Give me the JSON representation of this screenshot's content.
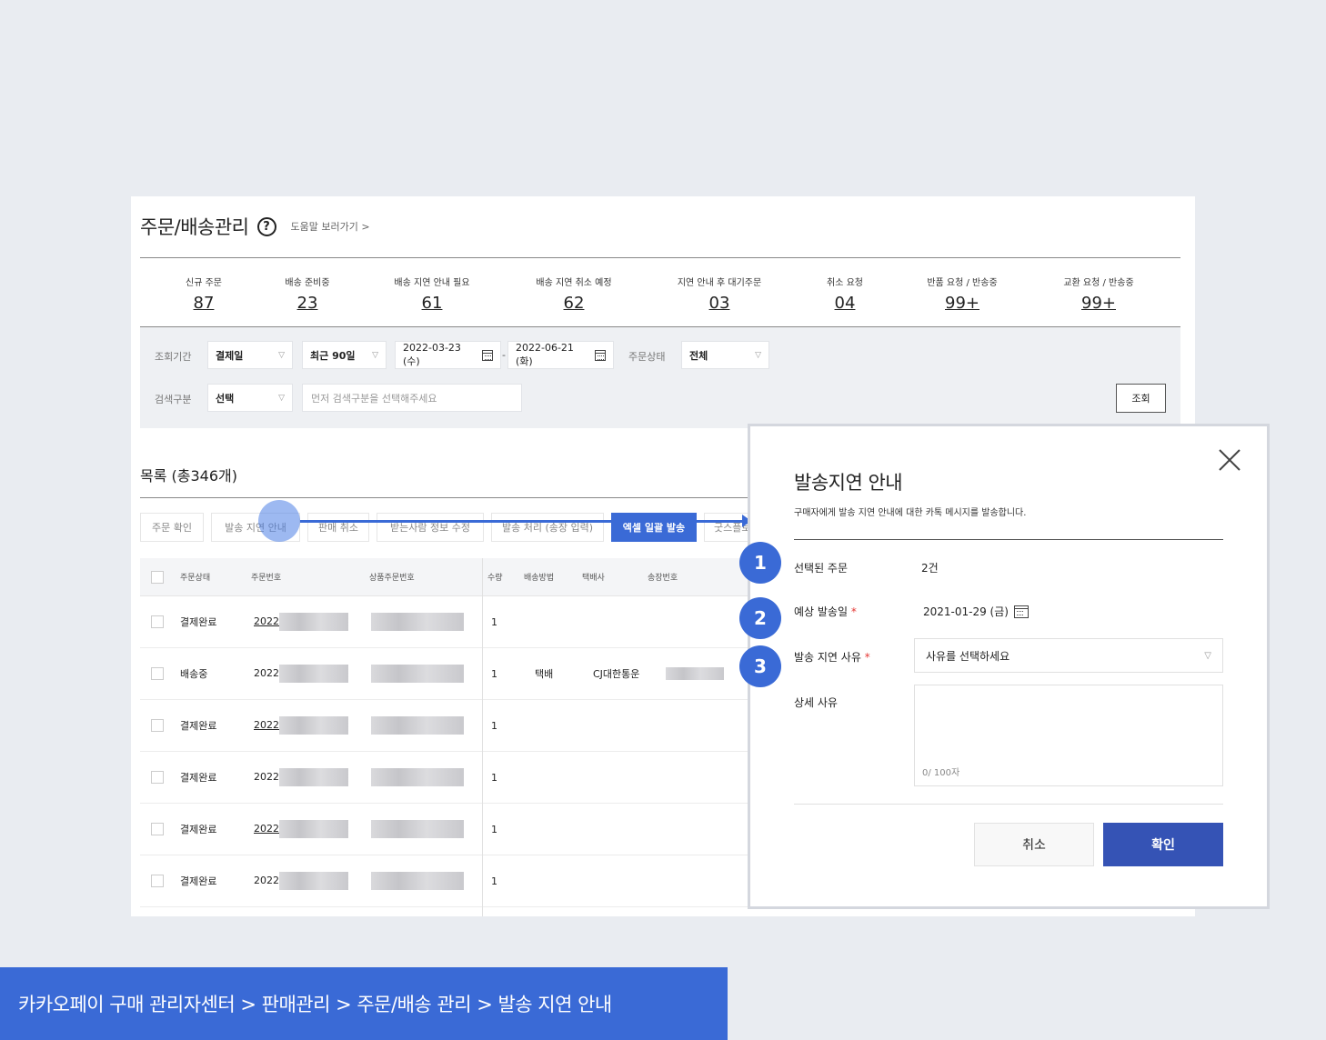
{
  "header": {
    "title": "주문/배송관리",
    "help_icon": "?",
    "help_link": "도움말 보러가기 >"
  },
  "stats": [
    {
      "label": "신규 주문",
      "value": "87"
    },
    {
      "label": "배송 준비중",
      "value": "23"
    },
    {
      "label": "배송 지연 안내 필요",
      "value": "61"
    },
    {
      "label": "배송 지연 취소 예정",
      "value": "62"
    },
    {
      "label": "지연 안내 후 대기주문",
      "value": "03"
    },
    {
      "label": "취소 요청",
      "value": "04"
    },
    {
      "label": "반품 요청 / 반송중",
      "value": "99+"
    },
    {
      "label": "교환 요청 / 반송중",
      "value": "99+"
    }
  ],
  "filters": {
    "period_label": "조회기간",
    "period_type": "결제일",
    "period_range": "최근 90일",
    "date_from": "2022-03-23 (수)",
    "date_sep": "-",
    "date_to": "2022-06-21 (화)",
    "status_label": "주문상태",
    "status_value": "전체",
    "search_label": "검색구분",
    "search_type": "선택",
    "search_placeholder": "먼저 검색구분을 선택해주세요",
    "search_button": "조회"
  },
  "list": {
    "title": "목록 (총346개)",
    "tabs": [
      "주문 확인",
      "발송 지연 안내",
      "판매 취소",
      "받는사람 정보 수정",
      "발송 처리 (송장 입력)",
      "엑셀 일괄 발송",
      "굿스플로"
    ],
    "active_tab": "엑셀 일괄 발송",
    "columns": [
      "주문상태",
      "주문번호",
      "상품주문번호",
      "수량",
      "배송방법",
      "택배사",
      "송장번호"
    ],
    "rows": [
      {
        "status": "결제완료",
        "order_no": "2022",
        "qty": "1",
        "method": "",
        "courier": ""
      },
      {
        "status": "배송중",
        "order_no": "2022",
        "qty": "1",
        "method": "택배",
        "courier": "CJ대한통운"
      },
      {
        "status": "결제완료",
        "order_no": "2022",
        "qty": "1",
        "method": "",
        "courier": ""
      },
      {
        "status": "결제완료",
        "order_no": "2022",
        "qty": "1",
        "method": "",
        "courier": ""
      },
      {
        "status": "결제완료",
        "order_no": "2022",
        "qty": "1",
        "method": "",
        "courier": ""
      },
      {
        "status": "결제완료",
        "order_no": "2022",
        "qty": "1",
        "method": "",
        "courier": ""
      }
    ]
  },
  "modal": {
    "title": "발송지연 안내",
    "subtitle": "구매자에게 발송 지연 안내에 대한 카톡 메시지를 발송합니다.",
    "selected_label": "선택된 주문",
    "selected_value": "2건",
    "date_label": "예상 발송일",
    "date_value": "2021-01-29 (금)",
    "reason_label": "발송 지연 사유",
    "reason_placeholder": "사유를 선택하세요",
    "detail_label": "상세 사유",
    "char_count": "0/ 100자",
    "required_mark": "*",
    "cancel_label": "취소",
    "confirm_label": "확인"
  },
  "steps": [
    "1",
    "2",
    "3"
  ],
  "footer": {
    "breadcrumb": "카카오페이 구매 관리자센터 > 판매관리 > 주문/배송 관리 > 발송 지연 안내"
  },
  "colors": {
    "accent": "#3a6ad6",
    "confirm": "#3553b5",
    "required": "#e53935",
    "background": "#e9ecf1"
  }
}
